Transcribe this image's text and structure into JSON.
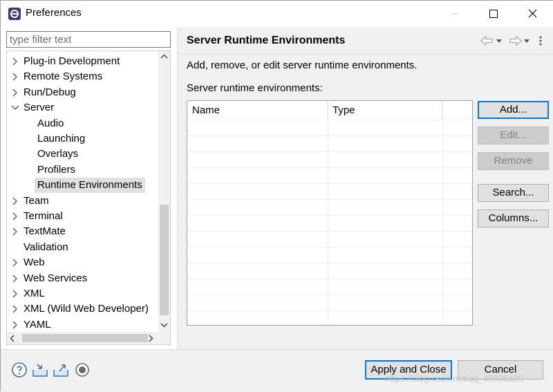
{
  "window": {
    "title": "Preferences"
  },
  "filter": {
    "placeholder": "type filter text",
    "value": ""
  },
  "tree": {
    "items": [
      {
        "label": "Plug-in Development",
        "expandable": true,
        "expanded": false,
        "level": 0
      },
      {
        "label": "Remote Systems",
        "expandable": true,
        "expanded": false,
        "level": 0
      },
      {
        "label": "Run/Debug",
        "expandable": true,
        "expanded": false,
        "level": 0
      },
      {
        "label": "Server",
        "expandable": true,
        "expanded": true,
        "level": 0
      },
      {
        "label": "Audio",
        "expandable": false,
        "level": 1
      },
      {
        "label": "Launching",
        "expandable": false,
        "level": 1
      },
      {
        "label": "Overlays",
        "expandable": false,
        "level": 1
      },
      {
        "label": "Profilers",
        "expandable": false,
        "level": 1
      },
      {
        "label": "Runtime Environments",
        "expandable": false,
        "level": 1,
        "selected": true
      },
      {
        "label": "Team",
        "expandable": true,
        "expanded": false,
        "level": 0
      },
      {
        "label": "Terminal",
        "expandable": true,
        "expanded": false,
        "level": 0
      },
      {
        "label": "TextMate",
        "expandable": true,
        "expanded": false,
        "level": 0
      },
      {
        "label": "Validation",
        "expandable": false,
        "level": 0
      },
      {
        "label": "Web",
        "expandable": true,
        "expanded": false,
        "level": 0
      },
      {
        "label": "Web Services",
        "expandable": true,
        "expanded": false,
        "level": 0
      },
      {
        "label": "XML",
        "expandable": true,
        "expanded": false,
        "level": 0
      },
      {
        "label": "XML (Wild Web Developer)",
        "expandable": true,
        "expanded": false,
        "level": 0
      },
      {
        "label": "YAML",
        "expandable": true,
        "expanded": false,
        "level": 0
      }
    ]
  },
  "page": {
    "title": "Server Runtime Environments",
    "description": "Add, remove, or edit server runtime environments.",
    "list_label": "Server runtime environments:",
    "columns": [
      "Name",
      "Type"
    ],
    "rows": []
  },
  "buttons": {
    "add": "Add...",
    "edit": "Edit...",
    "remove": "Remove",
    "search": "Search...",
    "columns": "Columns..."
  },
  "footer": {
    "apply_close": "Apply and Close",
    "cancel": "Cancel"
  },
  "watermark": "https://blog.csdn.net/qq_43606229",
  "colors": {
    "accent": "#0078d7",
    "selection": "#e0e0e0"
  }
}
